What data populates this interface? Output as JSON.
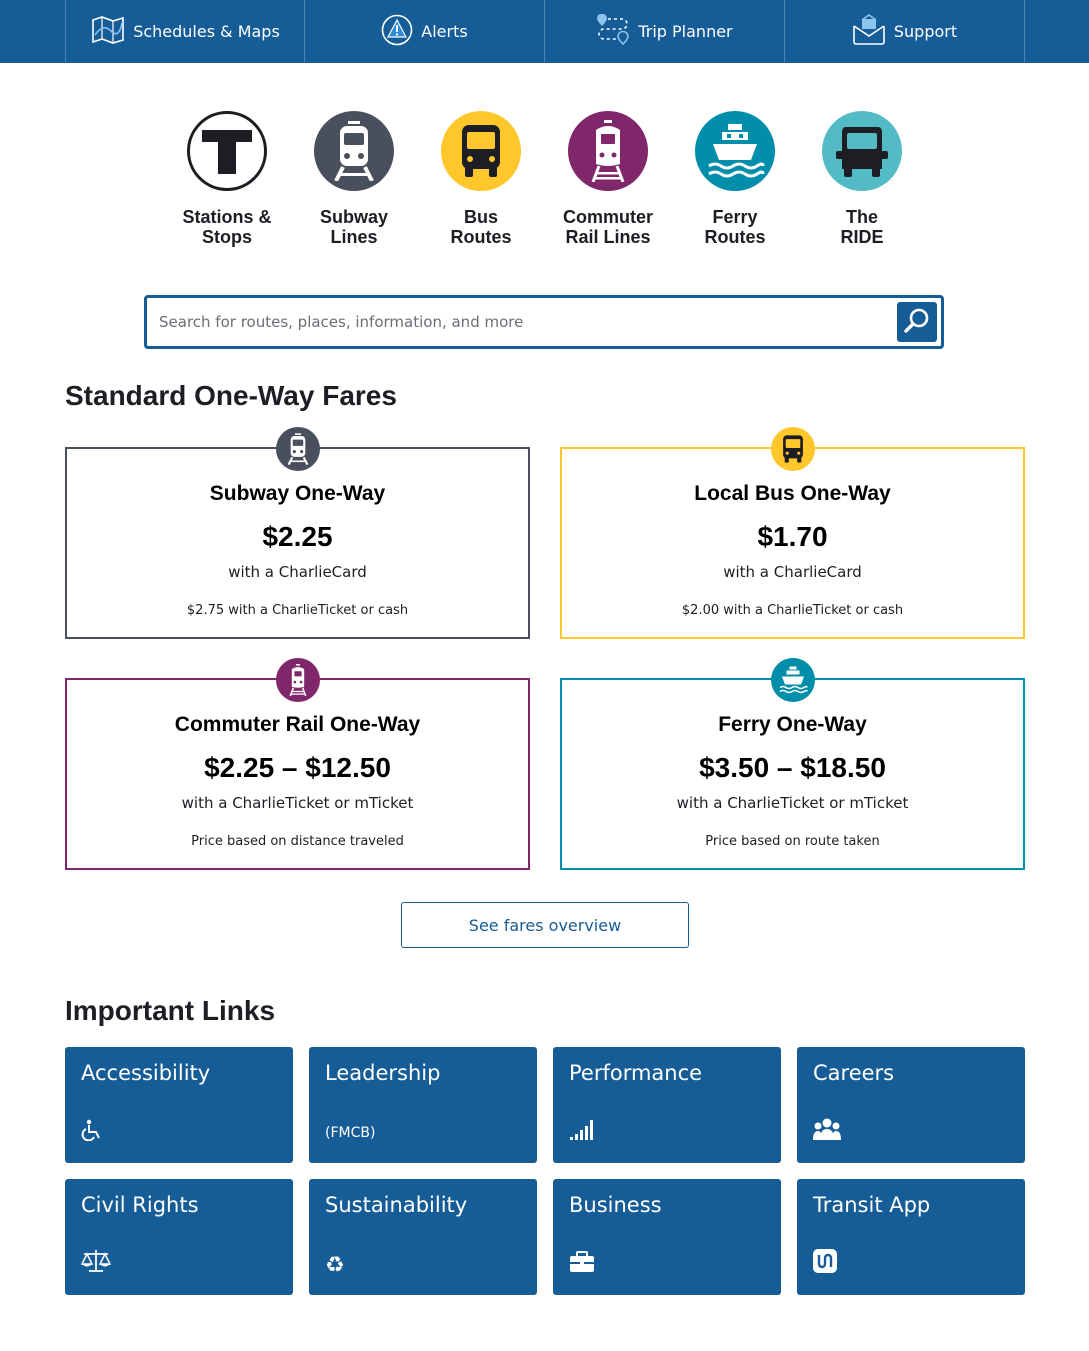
{
  "nav": {
    "items": [
      {
        "label": "Schedules & Maps",
        "icon": "map-icon"
      },
      {
        "label": "Alerts",
        "icon": "alert-icon"
      },
      {
        "label": "Trip Planner",
        "icon": "trip-planner-icon"
      },
      {
        "label": "Support",
        "icon": "support-envelope-icon"
      }
    ]
  },
  "modes": [
    {
      "line1": "Stations &",
      "line2": "Stops",
      "icon": "t-logo-icon",
      "color": "#ffffff"
    },
    {
      "line1": "Subway",
      "line2": "Lines",
      "icon": "subway-icon",
      "color": "#494f5c"
    },
    {
      "line1": "Bus",
      "line2": "Routes",
      "icon": "bus-icon",
      "color": "#ffc72c"
    },
    {
      "line1": "Commuter",
      "line2": "Rail Lines",
      "icon": "commuter-rail-icon",
      "color": "#80276c"
    },
    {
      "line1": "Ferry",
      "line2": "Routes",
      "icon": "ferry-icon",
      "color": "#008eaa"
    },
    {
      "line1": "The",
      "line2": "RIDE",
      "icon": "ride-van-icon",
      "color": "#52bbc5"
    }
  ],
  "search": {
    "placeholder": "Search for routes, places, information, and more",
    "value": ""
  },
  "fares": {
    "heading": "Standard One-Way Fares",
    "cards": [
      {
        "title": "Subway One-Way",
        "price": "$2.25",
        "with": "with a CharlieCard",
        "note": "$2.75 with a CharlieTicket or cash",
        "color": "#494f5c",
        "icon": "subway-icon"
      },
      {
        "title": "Local Bus One-Way",
        "price": "$1.70",
        "with": "with a CharlieCard",
        "note": "$2.00 with a CharlieTicket or cash",
        "color": "#ffc72c",
        "icon": "bus-icon"
      },
      {
        "title": "Commuter Rail One-Way",
        "price": "$2.25 – $12.50",
        "with": "with a CharlieTicket or mTicket",
        "note": "Price based on distance traveled",
        "color": "#80276c",
        "icon": "commuter-rail-icon"
      },
      {
        "title": "Ferry One-Way",
        "price": "$3.50 – $18.50",
        "with": "with a CharlieTicket or mTicket",
        "note": "Price based on route taken",
        "color": "#008eaa",
        "icon": "ferry-icon"
      }
    ],
    "overview_button": "See fares overview"
  },
  "links": {
    "heading": "Important Links",
    "tiles": [
      {
        "title": "Accessibility",
        "sub": "",
        "icon": "wheelchair-icon"
      },
      {
        "title": "Leadership",
        "sub": "(FMCB)",
        "icon": ""
      },
      {
        "title": "Performance",
        "sub": "",
        "icon": "signal-bars-icon"
      },
      {
        "title": "Careers",
        "sub": "",
        "icon": "people-group-icon"
      },
      {
        "title": "Civil Rights",
        "sub": "",
        "icon": "balance-scale-icon"
      },
      {
        "title": "Sustainability",
        "sub": "",
        "icon": "recycle-icon"
      },
      {
        "title": "Business",
        "sub": "",
        "icon": "briefcase-icon"
      },
      {
        "title": "Transit App",
        "sub": "",
        "icon": "transit-app-icon"
      }
    ]
  },
  "colors": {
    "primary": "#165c96",
    "subway": "#494f5c",
    "bus": "#ffc72c",
    "commuter_rail": "#80276c",
    "ferry": "#008eaa",
    "ride": "#52bbc5"
  }
}
